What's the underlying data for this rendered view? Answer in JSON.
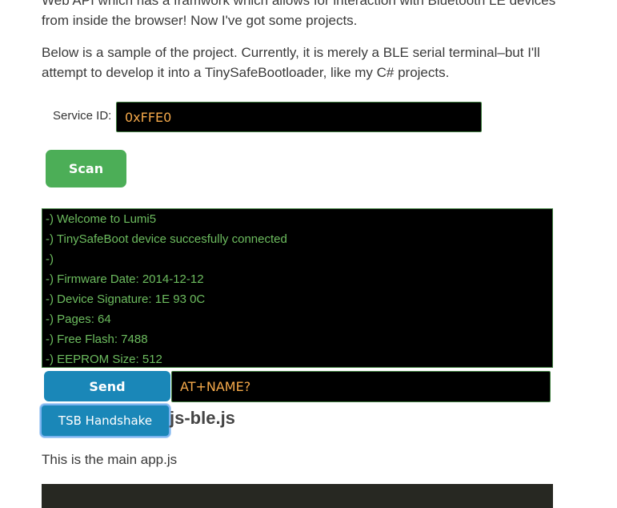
{
  "article": {
    "intro_paragraph": "Web API which has a framwork which allows for interaction with Bluetooth LE devices from inside the browser! Now I've got some projects.",
    "sample_paragraph": "Below is a sample of the project. Currently, it is merely a BLE serial terminal–but I'll attempt to develop it into a TinySafeBootloader, like my C# projects.",
    "file_heading": "js-ble.js",
    "main_app_paragraph": "This is the main app.js"
  },
  "service": {
    "label": "Service ID:",
    "value": "0xFFE0"
  },
  "scan_button": {
    "label": "Scan"
  },
  "terminal": {
    "lines": [
      "-) Welcome to Lumi5",
      "-) TinySafeBoot device succesfully connected",
      "-)",
      "-) Firmware Date: 2014-12-12",
      "-) Device Signature: 1E 93 0C",
      "-) Pages: 64",
      "-) Free Flash: 7488",
      "-) EEPROM Size: 512"
    ]
  },
  "send_button": {
    "label": "Send"
  },
  "command_input": {
    "value": "AT+NAME?"
  },
  "tsb_button": {
    "label": "TSB Handshake"
  },
  "colors": {
    "scan_button": "#4cae57",
    "primary_button": "#1a87b8",
    "terminal_bg": "#000000",
    "terminal_text": "#6dbd5f",
    "input_text": "#f5a94a",
    "code_block_bg": "#272822"
  }
}
